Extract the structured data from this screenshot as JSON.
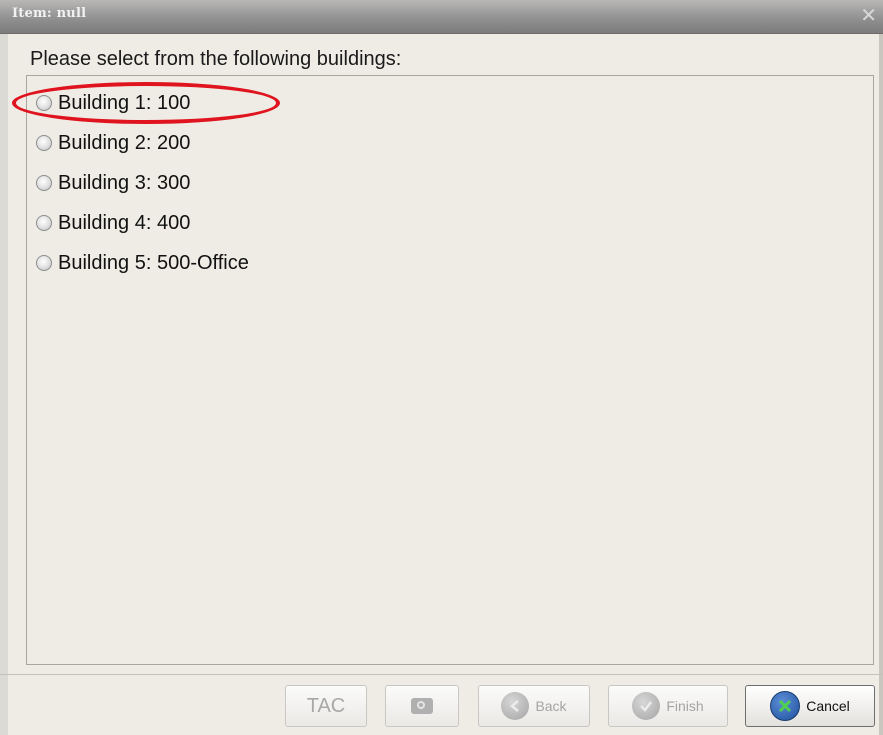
{
  "window": {
    "title": "Item: null",
    "close_glyph": "✕"
  },
  "prompt": "Please select from the following buildings:",
  "options": [
    {
      "label": "Building 1: 100",
      "selected": false,
      "highlighted": true
    },
    {
      "label": "Building 2: 200",
      "selected": false
    },
    {
      "label": "Building 3: 300",
      "selected": false
    },
    {
      "label": "Building 4: 400",
      "selected": false
    },
    {
      "label": "Building 5: 500-Office",
      "selected": false
    }
  ],
  "buttons": {
    "tac": {
      "label": "TAC",
      "enabled": false
    },
    "camera": {
      "icon": "camera-icon",
      "enabled": false
    },
    "back": {
      "label": "Back",
      "icon": "back-arrow-icon",
      "enabled": false
    },
    "finish": {
      "label": "Finish",
      "icon": "checkmark-icon",
      "enabled": false
    },
    "cancel": {
      "label": "Cancel",
      "icon": "x-icon",
      "enabled": true
    }
  },
  "colors": {
    "highlight": "#e0141e",
    "cancel_icon": "#1d4f9c",
    "cancel_x": "#4fd14f"
  }
}
